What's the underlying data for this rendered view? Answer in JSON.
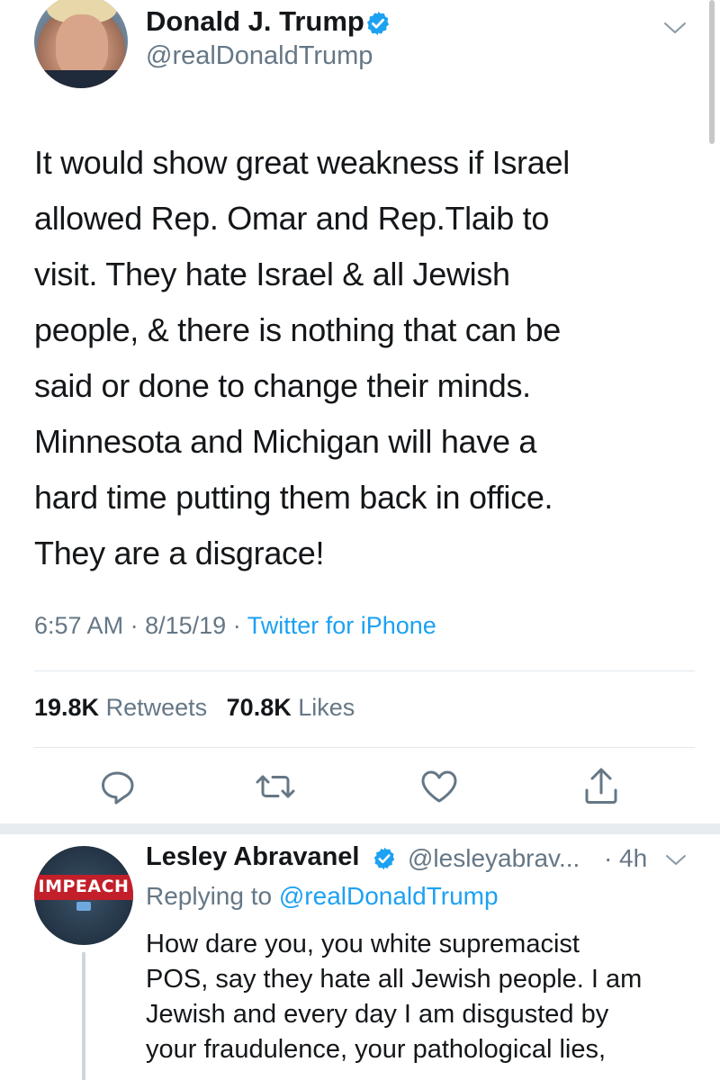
{
  "tweet": {
    "author_name": "Donald J. Trump",
    "author_handle": "@realDonaldTrump",
    "text_lines": [
      "It would show great weakness if Israel",
      "allowed Rep. Omar and Rep.Tlaib to",
      "visit. They hate Israel & all Jewish",
      "people, & there is nothing that can be",
      "said or done to change their minds.",
      "Minnesota and Michigan will have a",
      "hard time putting them back in office.",
      "They are a disgrace!"
    ],
    "time": "6:57 AM",
    "date": "8/15/19",
    "separator": "·",
    "source": "Twitter for iPhone",
    "retweets_count": "19.8K",
    "retweets_label": "Retweets",
    "likes_count": "70.8K",
    "likes_label": "Likes",
    "icons": {
      "verified": "verified-badge-icon",
      "more": "chevron-down-icon",
      "reply": "reply-icon",
      "retweet": "retweet-icon",
      "like": "heart-icon",
      "share": "share-icon"
    }
  },
  "reply": {
    "author_name": "Lesley Abravanel",
    "author_handle": "@lesleyabrav...",
    "time_separator": "·",
    "time_ago": "4h",
    "replying_prefix": "Replying to",
    "replying_to": "@realDonaldTrump",
    "avatar_text": "IMPEACH",
    "text_lines": [
      "How dare you, you white supremacist",
      "POS, say they hate all Jewish people. I am",
      "Jewish and every day I am disgusted by",
      "your fraudulence, your pathological lies,"
    ]
  },
  "colors": {
    "text": "#14171a",
    "secondary": "#657786",
    "accent": "#1da1f2",
    "divider": "#e1e8ed"
  }
}
